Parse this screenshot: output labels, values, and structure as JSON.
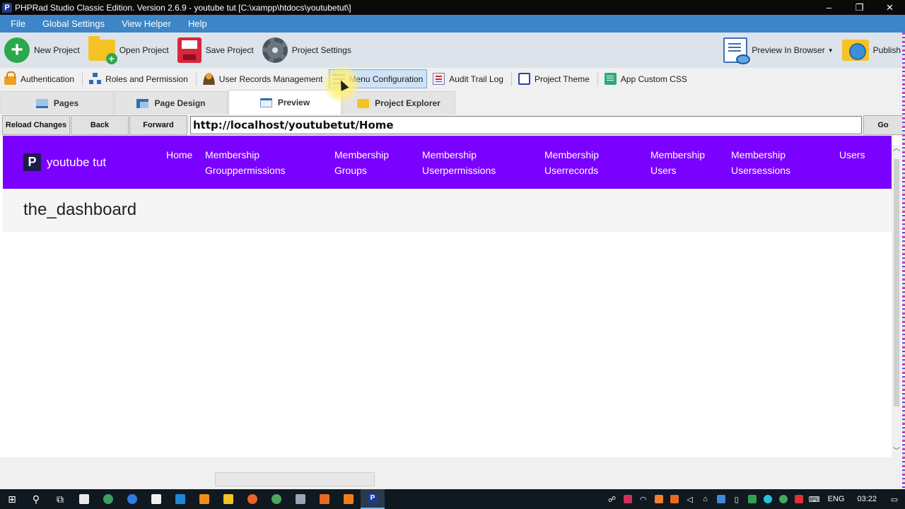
{
  "window": {
    "app_icon_letter": "P",
    "title": "PHPRad Studio Classic Edition.  Version 2.6.9 - youtube tut [C:\\xampp\\htdocs\\youtubetut\\]",
    "minimize": "–",
    "maximize": "❐",
    "close": "✕"
  },
  "menubar": {
    "items": [
      "File",
      "Global Settings",
      "View Helper",
      "Help"
    ]
  },
  "toolbar": {
    "new_project": "New Project",
    "open_project": "Open Project",
    "save_project": "Save Project",
    "project_settings": "Project Settings",
    "preview_in_browser": "Preview In Browser",
    "publish": "Publish"
  },
  "toolbar2": {
    "authentication": "Authentication",
    "roles_and_permission": "Roles and Permission",
    "user_records_management": "User Records Management",
    "menu_configuration": "Menu Configuration",
    "audit_trail_log": "Audit Trail Log",
    "project_theme": "Project Theme",
    "app_custom_css": "App Custom CSS"
  },
  "tabs": [
    {
      "label": "Pages",
      "active": false
    },
    {
      "label": "Page Design",
      "active": false
    },
    {
      "label": "Preview",
      "active": true
    },
    {
      "label": "Project Explorer",
      "active": false
    }
  ],
  "addressbar": {
    "reload_changes": "Reload Changes",
    "back": "Back",
    "forward": "Forward",
    "url": "http://localhost/youtubetut/Home",
    "go": "Go"
  },
  "site": {
    "logo_letter": "P",
    "brand": "youtube tut",
    "nav": [
      {
        "line1": "Home",
        "line2": ""
      },
      {
        "line1": "Membership",
        "line2": "Grouppermissions"
      },
      {
        "line1": "Membership",
        "line2": "Groups"
      },
      {
        "line1": "Membership",
        "line2": "Userpermissions"
      },
      {
        "line1": "Membership",
        "line2": "Userrecords"
      },
      {
        "line1": "Membership",
        "line2": "Users"
      },
      {
        "line1": "Membership",
        "line2": "Usersessions"
      },
      {
        "line1": "Users",
        "line2": ""
      }
    ],
    "heading": "the_dashboard",
    "nav_color": "#7a00ff"
  },
  "scroll_arrows": {
    "up": "︿",
    "down": "﹀"
  },
  "taskbar": {
    "start_icon": "⊞",
    "search_icon": "⚲",
    "task_view_icon": "⧉",
    "language": "ENG",
    "time": "03:22"
  },
  "colors": {
    "menubar": "#3d85c6",
    "toolbar": "#dde3ea",
    "accent_active": "#cfe3f7"
  }
}
